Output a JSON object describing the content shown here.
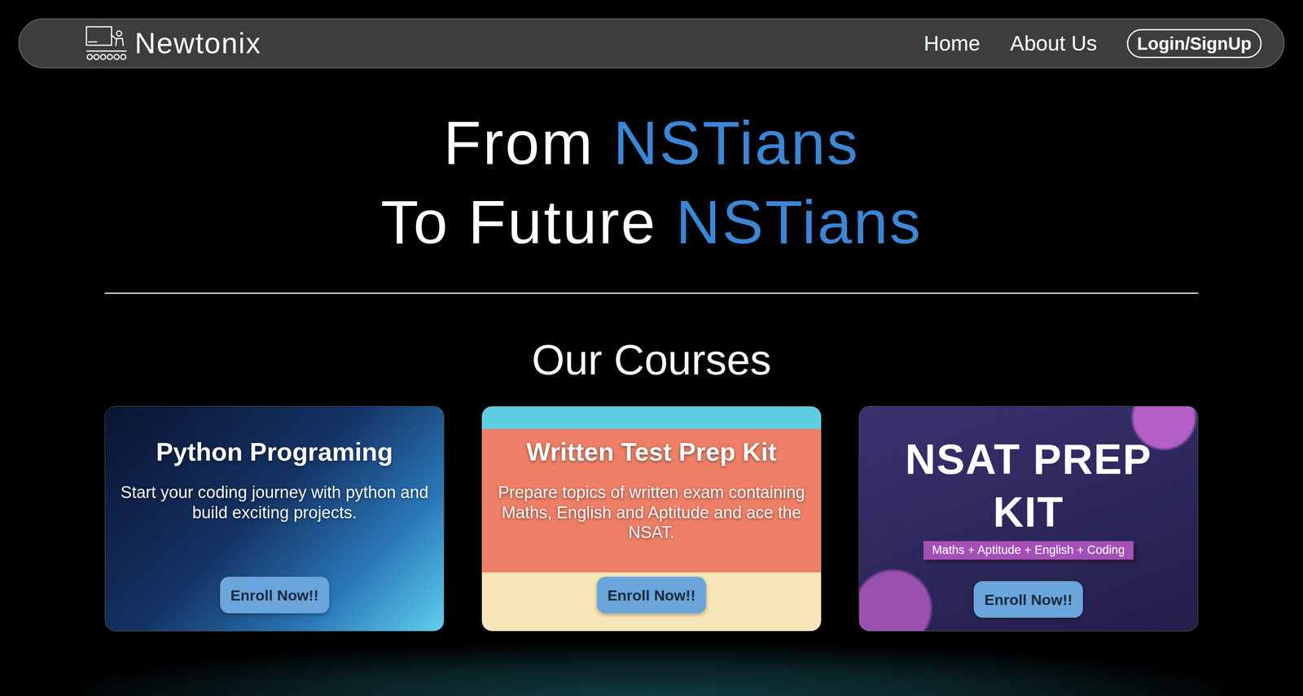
{
  "brand": {
    "name": "Newtonix"
  },
  "nav": {
    "links": [
      {
        "label": "Home"
      },
      {
        "label": "About Us"
      }
    ],
    "login": "Login/SignUp"
  },
  "hero": {
    "lines": [
      {
        "prefix": "From",
        "highlight": "NSTians"
      },
      {
        "prefix": "To Future",
        "highlight": "NSTians"
      }
    ]
  },
  "courses": {
    "title": "Our Courses",
    "items": [
      {
        "kind": "photo",
        "title": "Python Programing",
        "description": "Start your coding journey with python and build exciting projects.",
        "button": "Enroll Now!!"
      },
      {
        "kind": "illustration",
        "title": "Written Test Prep Kit",
        "description": "Prepare topics of written exam containing Maths, English and Aptitude and ace the NSAT.",
        "button": "Enroll Now!!"
      },
      {
        "kind": "poster",
        "title": "NSAT PREP KIT",
        "tag": "Maths + Aptitude + English + Coding",
        "button": "Enroll Now!!"
      }
    ]
  }
}
